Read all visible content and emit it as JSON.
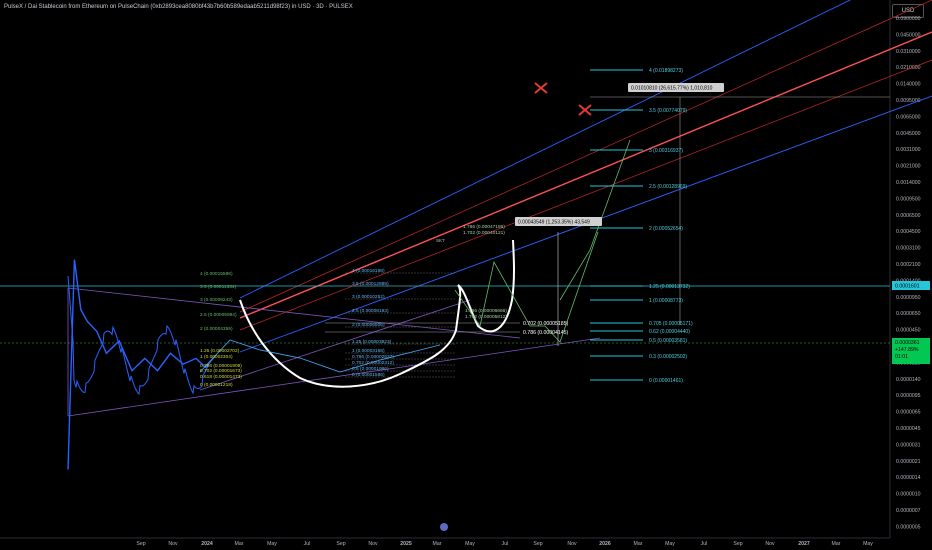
{
  "header": {
    "title": "PulseX / Dai Stablecoin from Ethereum on PulseChain (0xb2893cea8080bf43b7b60b589edaab5211d98f23) in USD · 3D · PULSEX",
    "currency": "USD"
  },
  "chart_data": {
    "type": "line",
    "yscale": "log",
    "ylim": [
      4.8e-06,
      0.09
    ],
    "y_ticks": [
      "0.0900000",
      "0.0450000",
      "0.0310000",
      "0.0210000",
      "0.0140000",
      "0.0095000",
      "0.0065000",
      "0.0045000",
      "0.0031000",
      "0.0021000",
      "0.0014000",
      "0.0009500",
      "0.0006500",
      "0.0004500",
      "0.0003100",
      "0.0002100",
      "0.0001400",
      "0.0000950",
      "0.0000650",
      "0.0000450",
      "0.0000310",
      "0.0000210",
      "0.0000140",
      "0.0000095",
      "0.0000065",
      "0.0000045",
      "0.0000031",
      "0.0000021",
      "0.0000014",
      "0.0000010",
      "0.0000007",
      "0.0000005"
    ],
    "x_ticks": [
      "Sep",
      "Nov",
      "2024",
      "Mar",
      "May",
      "Jul",
      "Sep",
      "Nov",
      "2025",
      "Mar",
      "May",
      "Jul",
      "Sep",
      "Nov",
      "2026",
      "Mar",
      "May",
      "Jul",
      "Sep",
      "Nov",
      "2027",
      "Mar",
      "May"
    ],
    "price_labels": {
      "last_price": "0.0000361",
      "change": "+147.89%",
      "countdown": "01:01",
      "marker_price": "0.0001601"
    },
    "fib_left": [
      "4 (0.00015586)",
      "3.5 (0.00011334)",
      "3 (0.00008243)",
      "2.5 (0.00005994)",
      "2 (0.00004359)",
      "1.25 (0.00002702)",
      "1 (0.00002304)",
      "0.786 (0.00001909)",
      "0.702 (0.00001673)",
      "0.618 (0.00001473)",
      "0 (0.00001218)"
    ],
    "fib_mid": [
      "4 (0.00016198)",
      "3.5 (0.00012889)",
      "3 (0.00010252)",
      "2.5 (0.00008193)",
      "2 (0.00006506)",
      "1.25 (0.00003923)",
      "1 (0.00003168)",
      "0.786 (0.00002637)",
      "0.702 (0.00002312)",
      "0.5 (0.00001986)",
      "0 (0.00001586)"
    ],
    "fib_right": [
      "4 (0.01898273)",
      "3.5 (0.00774079)",
      "3 (0.00316937)",
      "2.5 (0.00128969)",
      "2 (0.00052654)",
      "1.25 (0.00013732)",
      "1 (0.00008773)",
      "0.705 (0.00005171)",
      "0.62 (0.00004440)",
      "0.5 (0.00003581)",
      "0.3 (0.00002502)",
      "0 (0.00001461)"
    ],
    "fib_upper": [
      "1.786 (0.00047186)",
      "1.702 (0.00040121)",
      "1.786 (0.00006666)",
      "1.702 (0.00005812)"
    ],
    "fib_near": [
      "0.702 (0.00005185)",
      "0.786 (0.00004145)"
    ],
    "annotations": {
      "target_1": "0.01010810 (26,615.77%) 1,010,810",
      "target_2": "0.00043549 (1,253.35%) 43,549",
      "mini_label": "SKT"
    },
    "series": [
      {
        "name": "",
        "points": [
          [
            0,
            1.2e-06
          ],
          [
            2,
            0.00016
          ],
          [
            4,
            5e-05
          ],
          [
            6,
            3.8e-05
          ],
          [
            9,
            3e-05
          ],
          [
            12,
            1.8e-05
          ],
          [
            16,
            2.4e-05
          ],
          [
            20,
            1.2e-05
          ],
          [
            24,
            1.6e-05
          ],
          [
            28,
            1.2e-05
          ],
          [
            32,
            1.8e-05
          ],
          [
            36,
            1.4e-05
          ],
          [
            40,
            1.6e-05
          ],
          [
            43,
            1.3e-05
          ],
          [
            46,
            1.7e-05
          ]
        ]
      }
    ]
  }
}
